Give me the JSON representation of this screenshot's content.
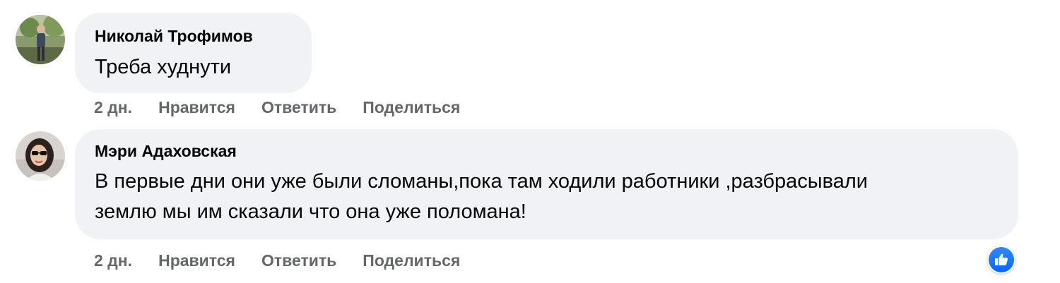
{
  "comments": [
    {
      "author": "Николай Трофимов",
      "text_lines": [
        "Треба худнути"
      ],
      "time": "2 дн.",
      "actions": {
        "like": "Нравится",
        "reply": "Ответить",
        "share": "Поделиться"
      },
      "avatar_icon": "user-avatar-photo"
    },
    {
      "author": "Мэри Адаховская",
      "text_lines": [
        "В первые дни они уже были сломаны,пока там ходили работники ,разбрасывали",
        "землю мы им сказали что она уже поломана!"
      ],
      "time": "2 дн.",
      "actions": {
        "like": "Нравится",
        "reply": "Ответить",
        "share": "Поделиться"
      },
      "avatar_icon": "user-avatar-photo",
      "reaction": {
        "icon": "thumbs-up-icon",
        "color": "#0866ff"
      }
    }
  ],
  "colors": {
    "bubble": "#f0f2f5",
    "secondary_text": "#65676b",
    "primary_text": "#050505"
  }
}
